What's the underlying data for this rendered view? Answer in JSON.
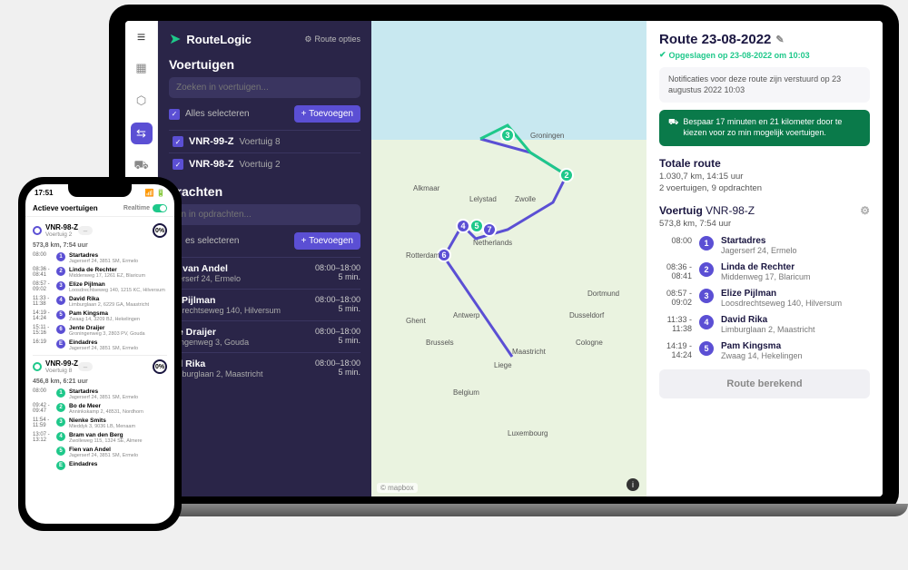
{
  "brand": {
    "name": "RouteLogic",
    "options_label": "Route opties"
  },
  "sidebar": {
    "vehicles_title": "Voertuigen",
    "vehicles_search_ph": "Zoeken in voertuigen...",
    "select_all": "Alles selecteren",
    "add_label": "+ Toevoegen",
    "vehicles": [
      {
        "id": "VNR-99-Z",
        "name": "Voertuig 8"
      },
      {
        "id": "VNR-98-Z",
        "name": "Voertuig 2"
      }
    ],
    "orders_title": "drachten",
    "orders_search_ph": "en in opdrachten...",
    "orders_select": "es selecteren",
    "orders": [
      {
        "name": "en van Andel",
        "addr": "agerserf 24, Ermelo",
        "win": "08:00–18:00",
        "dur": "5 min."
      },
      {
        "name": "ze Pijlman",
        "addr": "osdrechtseweg 140, Hilversum",
        "win": "08:00–18:00",
        "dur": "5 min."
      },
      {
        "name": "nte Draijer",
        "addr": "oningenweg 3, Gouda",
        "win": "08:00–18:00",
        "dur": "5 min."
      },
      {
        "name": "vid Rika",
        "addr": "Limburglaan 2, Maastricht",
        "win": "08:00–18:00",
        "dur": "5 min."
      }
    ]
  },
  "map": {
    "attribution": "© mapbox",
    "cities": [
      "Groningen",
      "Alkmaar",
      "Lelystad",
      "Zwolle",
      "Netherlands",
      "Rotterdam",
      "Dortmund",
      "Dusseldorf",
      "Antwerp",
      "Ghent",
      "Brussels",
      "Cologne",
      "Liege",
      "Belgium",
      "Luxembourg",
      "Maastricht"
    ]
  },
  "panel": {
    "title": "Route 23-08-2022",
    "saved": "Opgeslagen op 23-08-2022 om 10:03",
    "notification": "Notificaties voor deze route zijn verstuurd op 23 augustus 2022 10:03",
    "tip": "Bespaar 17 minuten en 21 kilometer door te kiezen voor zo min mogelijk voertuigen.",
    "total_title": "Totale route",
    "total_stat1": "1.030,7 km, 14:15 uur",
    "total_stat2": "2 voertuigen, 9 opdrachten",
    "vehicle_label": "Voertuig",
    "vehicle_id": "VNR-98-Z",
    "vehicle_stat": "573,8 km, 7:54 uur",
    "stops": [
      {
        "time": "08:00",
        "num": "1",
        "name": "Startadres",
        "addr": "Jagerserf 24, Ermelo"
      },
      {
        "time": "08:36 - 08:41",
        "num": "2",
        "name": "Linda de Rechter",
        "addr": "Middenweg 17, Blaricum"
      },
      {
        "time": "08:57 - 09:02",
        "num": "3",
        "name": "Elize Pijlman",
        "addr": "Loosdrechtseweg 140, Hilversum"
      },
      {
        "time": "11:33 - 11:38",
        "num": "4",
        "name": "David Rika",
        "addr": "Limburglaan 2, Maastricht"
      },
      {
        "time": "14:19 - 14:24",
        "num": "5",
        "name": "Pam Kingsma",
        "addr": "Zwaag 14, Hekelingen"
      }
    ],
    "calc_label": "Route berekend"
  },
  "phone": {
    "time": "17:51",
    "header": "Actieve voertuigen",
    "realtime": "Realtime",
    "veh1": {
      "id": "VNR-98-Z",
      "name": "Voertuig 2",
      "badge": "0%",
      "stat": "573,8 km, 7:54 uur",
      "stops": [
        {
          "t": "08:00",
          "n": "1",
          "nm": "Startadres",
          "ad": "Jagerserf 24, 3851 SM, Ermelo"
        },
        {
          "t": "08:36 - 08:41",
          "n": "2",
          "nm": "Linda de Rechter",
          "ad": "Middenweg 17, 1261 EZ, Blaricum"
        },
        {
          "t": "08:57 - 09:02",
          "n": "3",
          "nm": "Elize Pijlman",
          "ad": "Loosdrechtseweg 140, 1215 KC, Hilversum"
        },
        {
          "t": "11:33 - 11:38",
          "n": "4",
          "nm": "David Rika",
          "ad": "Limburglaan 2, 6229 GA, Maastricht"
        },
        {
          "t": "14:19 - 14:24",
          "n": "5",
          "nm": "Pam Kingsma",
          "ad": "Zwaag 14, 3209 BJ, Hekelingen"
        },
        {
          "t": "15:11 - 15:16",
          "n": "6",
          "nm": "Jente Draijer",
          "ad": "Groningenweg 3, 2803 PV, Gouda"
        },
        {
          "t": "16:19",
          "n": "E",
          "nm": "Eindadres",
          "ad": "Jagerserf 24, 3851 SM, Ermelo"
        }
      ]
    },
    "veh2": {
      "id": "VNR-99-Z",
      "name": "Voertuig 8",
      "badge": "0%",
      "stat": "456,8 km, 6:21 uur",
      "stops": [
        {
          "t": "08:00",
          "n": "1",
          "nm": "Startadres",
          "ad": "Jagerserf 24, 3851 SM, Ermelo"
        },
        {
          "t": "09:42 - 09:47",
          "n": "2",
          "nm": "Bo de Meer",
          "ad": "Anninkskamp 2, 48531, Nordhorn"
        },
        {
          "t": "11:54 - 11:59",
          "n": "3",
          "nm": "Nienke Smits",
          "ad": "Mieddyk 3, 9036 LB, Menaam"
        },
        {
          "t": "13:07 - 13:12",
          "n": "4",
          "nm": "Bram van den Berg",
          "ad": "Zwolleweg 115, 1324 SE, Almere"
        },
        {
          "t": "",
          "n": "5",
          "nm": "Fien van Andel",
          "ad": "Jagerserf 24, 3851 SM, Ermelo"
        },
        {
          "t": "",
          "n": "E",
          "nm": "Eindadres",
          "ad": ""
        }
      ]
    }
  }
}
